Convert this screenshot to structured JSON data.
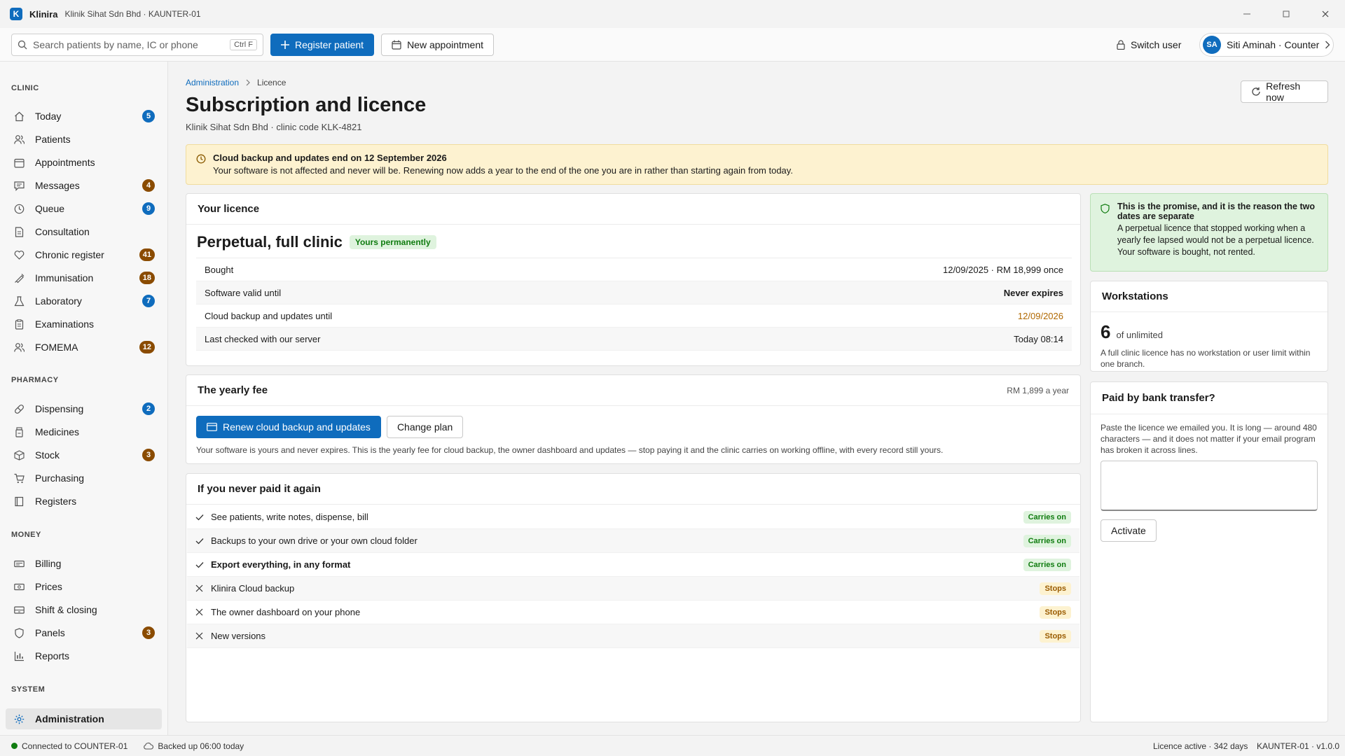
{
  "window": {
    "app_logo": "K",
    "app_name": "Klinira",
    "subtitle": "Klinik Sihat Sdn Bhd · KAUNTER-01"
  },
  "toolbar": {
    "search_placeholder": "Search patients by name, IC or phone",
    "search_shortcut": "Ctrl F",
    "register_label": "Register patient",
    "appointment_label": "New appointment",
    "switch_user_label": "Switch user",
    "user_initials": "SA",
    "user_name": "Siti Aminah · Counter"
  },
  "sidebar": {
    "sections": {
      "clinic": "CLINIC",
      "pharmacy": "PHARMACY",
      "money": "MONEY",
      "system": "SYSTEM"
    },
    "clinic_items": [
      {
        "label": "Today",
        "badge": "5",
        "icon": "home-icon"
      },
      {
        "label": "Patients",
        "badge": "",
        "icon": "people-icon"
      },
      {
        "label": "Appointments",
        "badge": "",
        "icon": "calendar-icon"
      },
      {
        "label": "Messages",
        "badge": "4",
        "icon": "chat-icon"
      },
      {
        "label": "Queue",
        "badge": "9",
        "icon": "clock-icon"
      },
      {
        "label": "Consultation",
        "badge": "",
        "icon": "document-icon"
      },
      {
        "label": "Chronic register",
        "badge": "41",
        "icon": "heart-icon"
      },
      {
        "label": "Immunisation",
        "badge": "18",
        "icon": "syringe-icon"
      },
      {
        "label": "Laboratory",
        "badge": "7",
        "icon": "flask-icon"
      },
      {
        "label": "Examinations",
        "badge": "",
        "icon": "clipboard-icon"
      },
      {
        "label": "FOMEMA",
        "badge": "12",
        "icon": "people-icon"
      }
    ],
    "pharmacy_items": [
      {
        "label": "Dispensing",
        "badge": "2",
        "icon": "pill-icon"
      },
      {
        "label": "Medicines",
        "badge": "",
        "icon": "medicine-icon"
      },
      {
        "label": "Stock",
        "badge": "3",
        "icon": "box-icon"
      },
      {
        "label": "Purchasing",
        "badge": "",
        "icon": "cart-icon"
      },
      {
        "label": "Registers",
        "badge": "",
        "icon": "book-icon"
      }
    ],
    "money_items": [
      {
        "label": "Billing",
        "badge": "",
        "icon": "money-icon"
      },
      {
        "label": "Prices",
        "badge": "",
        "icon": "money-icon"
      },
      {
        "label": "Shift & closing",
        "badge": "",
        "icon": "drawer-icon"
      },
      {
        "label": "Panels",
        "badge": "3",
        "icon": "shield-icon"
      },
      {
        "label": "Reports",
        "badge": "",
        "icon": "chart-icon"
      }
    ],
    "system_items": [
      {
        "label": "Administration",
        "badge": "",
        "icon": "gear-icon"
      }
    ]
  },
  "breadcrumb": {
    "parent": "Administration",
    "current": "Licence"
  },
  "page": {
    "title": "Subscription and licence",
    "subtitle": "Klinik Sihat Sdn Bhd · clinic code KLK-4821",
    "refresh_label": "Refresh now"
  },
  "banner": {
    "title": "Cloud backup and updates end on 12 September 2026",
    "text": "Your software is not affected and never will be. Renewing now adds a year to the end of the one you are in rather than starting again from today."
  },
  "licence": {
    "heading": "Your licence",
    "name": "Perpetual, full clinic",
    "badge": "Yours permanently",
    "rows": [
      {
        "label": "Bought",
        "value": "12/09/2025 · RM 18,999 once"
      },
      {
        "label": "Software valid until",
        "value": "Never expires"
      },
      {
        "label": "Cloud backup and updates until",
        "value": "12/09/2026"
      },
      {
        "label": "Last checked with our server",
        "value": "Today 08:14"
      }
    ]
  },
  "fee": {
    "heading": "The yearly fee",
    "price": "RM 1,899 a year",
    "renew_label": "Renew cloud backup and updates",
    "change_label": "Change plan",
    "note": "Your software is yours and never expires. This is the yearly fee for cloud backup, the owner dashboard and updates — stop paying it and the clinic carries on working offline, with every record still yours."
  },
  "never": {
    "heading": "If you never paid it again",
    "rows": [
      {
        "text": "See patients, write notes, dispense, bill",
        "status": "Carries on"
      },
      {
        "text": "Backups to your own drive or your own cloud folder",
        "status": "Carries on"
      },
      {
        "text": "Export everything, in any format",
        "status": "Carries on"
      },
      {
        "text": "Klinira Cloud backup",
        "status": "Stops"
      },
      {
        "text": "The owner dashboard on your phone",
        "status": "Stops"
      },
      {
        "text": "New versions",
        "status": "Stops"
      }
    ]
  },
  "promise": {
    "title": "This is the promise, and it is the reason the two dates are separate",
    "text": "A perpetual licence that stopped working when a yearly fee lapsed would not be a perpetual licence. Your software is bought, not rented."
  },
  "workstations": {
    "heading": "Workstations",
    "count": "6",
    "of": "of unlimited",
    "note": "A full clinic licence has no workstation or user limit within one branch."
  },
  "bank": {
    "heading": "Paid by bank transfer?",
    "note": "Paste the licence we emailed you. It is long — around 480 characters — and it does not matter if your email program has broken it across lines.",
    "textarea_value": "",
    "activate_label": "Activate"
  },
  "statusbar": {
    "connection": "Connected to COUNTER-01",
    "backup": "Backed up 06:00 today",
    "licence": "Licence active · 342 days",
    "version": "KAUNTER-01 · v1.0.0"
  }
}
